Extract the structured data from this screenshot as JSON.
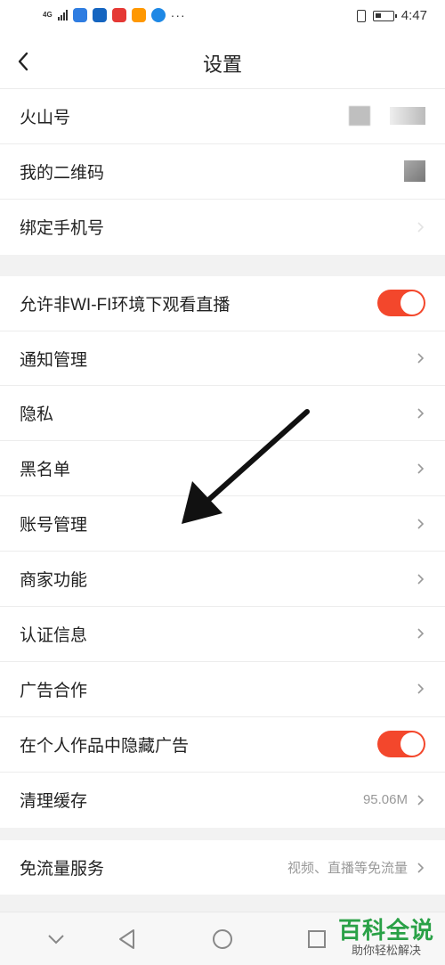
{
  "status_bar": {
    "network": "4G",
    "overflow": "···",
    "time": "4:47"
  },
  "header": {
    "title": "设置",
    "back_icon": "chevron-left-icon"
  },
  "groups": [
    {
      "rows": [
        {
          "label": "火山号",
          "type": "redacted"
        },
        {
          "label": "我的二维码",
          "type": "redacted-arrow"
        },
        {
          "label": "绑定手机号",
          "type": "arrow"
        }
      ]
    },
    {
      "rows": [
        {
          "label": "允许非WI-FI环境下观看直播",
          "type": "toggle",
          "on": true
        },
        {
          "label": "通知管理",
          "type": "arrow"
        },
        {
          "label": "隐私",
          "type": "arrow"
        },
        {
          "label": "黑名单",
          "type": "arrow"
        },
        {
          "label": "账号管理",
          "type": "arrow"
        },
        {
          "label": "商家功能",
          "type": "arrow"
        },
        {
          "label": "认证信息",
          "type": "arrow"
        },
        {
          "label": "广告合作",
          "type": "arrow"
        },
        {
          "label": "在个人作品中隐藏广告",
          "type": "toggle",
          "on": true
        },
        {
          "label": "清理缓存",
          "type": "value-arrow",
          "value": "95.06M"
        }
      ]
    },
    {
      "rows": [
        {
          "label": "免流量服务",
          "type": "value-arrow",
          "value": "视频、直播等免流量"
        }
      ]
    }
  ],
  "colors": {
    "toggle_on": "#f3472c",
    "watermark": "#2aa147"
  },
  "nav_bar": {
    "icons": [
      "collapse-icon",
      "back-triangle-icon",
      "home-circle-icon",
      "recents-square-icon"
    ]
  },
  "watermark": {
    "title": "百科全说",
    "subtitle": "助你轻松解决"
  }
}
